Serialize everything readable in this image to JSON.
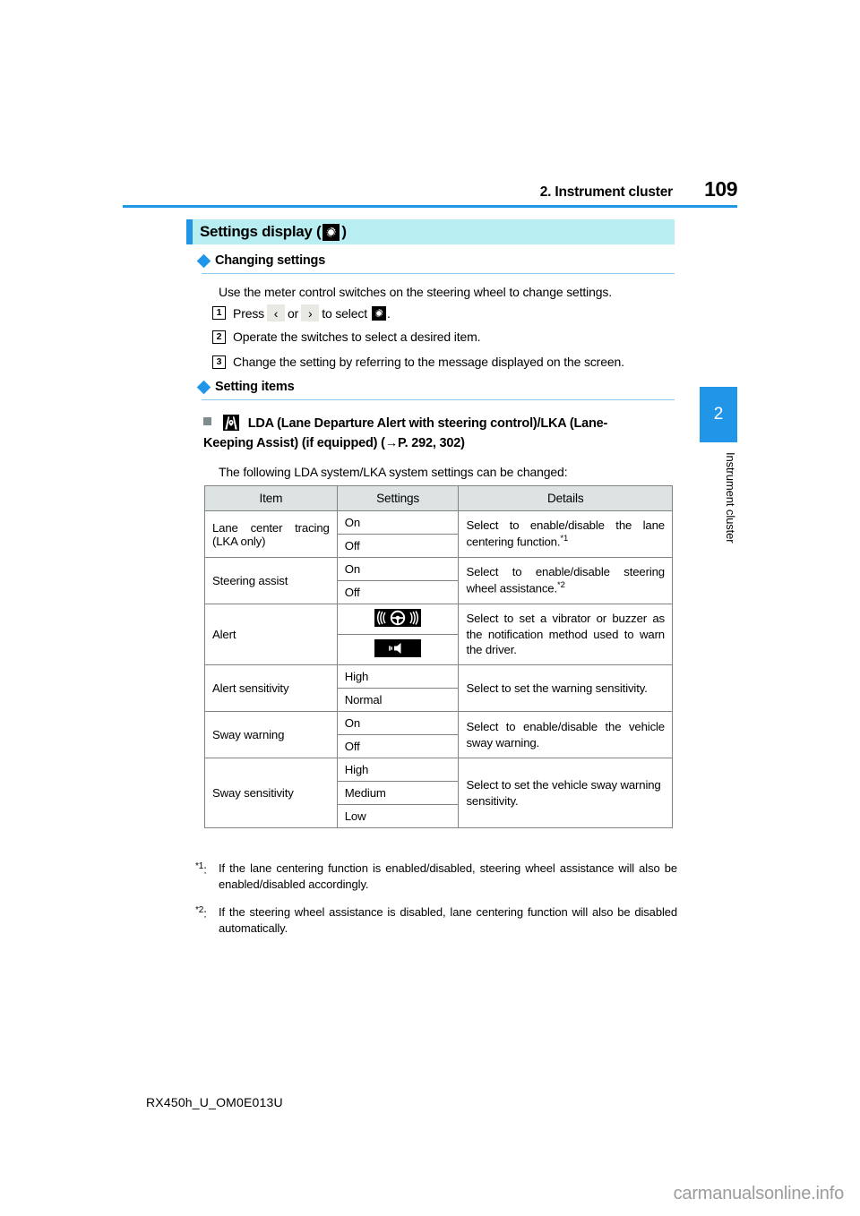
{
  "header": {
    "chapter_title": "2. Instrument cluster",
    "page_number": "109",
    "rule_color": "#2196e8"
  },
  "section": {
    "title_prefix": "Settings display (",
    "title_suffix": ")",
    "icon": "gear-icon",
    "band_color": "#b8eef2",
    "accent_color": "#2196e8"
  },
  "changing_settings": {
    "heading": "Changing settings",
    "intro": "Use the meter control switches on the steering wheel to change settings.",
    "steps": [
      {
        "num": "1",
        "text_before": "Press",
        "key_left": "‹",
        "conjunction": "or",
        "key_right": "›",
        "text_after": "to select",
        "icon": "gear-icon",
        "text_end": "."
      },
      {
        "num": "2",
        "text": "Operate the switches to select a desired item."
      },
      {
        "num": "3",
        "text": "Change the setting by referring to the message displayed on the screen."
      }
    ]
  },
  "setting_items": {
    "heading": "Setting items",
    "lda_icon": "lda-lane-departure-icon",
    "lda_heading": "LDA (Lane Departure Alert with steering control)/LKA (Lane-Keeping Assist) (if equipped) (→P. 292, 302)",
    "lda_intro": "The following LDA system/LKA system settings can be changed:"
  },
  "table": {
    "columns": [
      "Item",
      "Settings",
      "Details"
    ],
    "rows": [
      {
        "item": "Lane center tracing (LKA only)",
        "settings": [
          {
            "type": "text",
            "value": "On"
          },
          {
            "type": "text",
            "value": "Off"
          }
        ],
        "detail": "Select to enable/disable the lane centering function.",
        "detail_sup": "*1"
      },
      {
        "item": "Steering assist",
        "settings": [
          {
            "type": "text",
            "value": "On"
          },
          {
            "type": "text",
            "value": "Off"
          }
        ],
        "detail": "Select to enable/disable steering wheel assistance.",
        "detail_sup": "*2"
      },
      {
        "item": "Alert",
        "settings": [
          {
            "type": "icon",
            "value": "steering-wheel-vibration-icon"
          },
          {
            "type": "icon",
            "value": "speaker-buzzer-icon"
          }
        ],
        "detail": "Select to set a vibrator or buzzer as the notification method used to warn the driver.",
        "detail_sup": ""
      },
      {
        "item": "Alert sensitivity",
        "settings": [
          {
            "type": "text",
            "value": "High"
          },
          {
            "type": "text",
            "value": "Normal"
          }
        ],
        "detail": "Select to set the warning sensitivity.",
        "detail_sup": ""
      },
      {
        "item": "Sway warning",
        "settings": [
          {
            "type": "text",
            "value": "On"
          },
          {
            "type": "text",
            "value": "Off"
          }
        ],
        "detail": "Select to enable/disable the vehicle sway warning.",
        "detail_sup": ""
      },
      {
        "item": "Sway sensitivity",
        "settings": [
          {
            "type": "text",
            "value": "High"
          },
          {
            "type": "text",
            "value": "Medium"
          },
          {
            "type": "text",
            "value": "Low"
          }
        ],
        "detail": "Select to set the vehicle sway warning sensitivity.",
        "detail_sup": ""
      }
    ],
    "header_bg": "#dde3e3",
    "border_color": "#808285"
  },
  "footnotes": [
    {
      "mark": "*1",
      "text": "If the lane centering function is enabled/disabled, steering wheel assistance will also be enabled/disabled accordingly."
    },
    {
      "mark": "*2",
      "text": "If the steering wheel assistance is disabled, lane centering function will also be disabled automatically."
    }
  ],
  "side_tab": {
    "number": "2",
    "label": "Instrument cluster",
    "color": "#2196e8"
  },
  "footer": {
    "document_code": "RX450h_U_OM0E013U",
    "watermark": "carmanualsonline.info"
  }
}
